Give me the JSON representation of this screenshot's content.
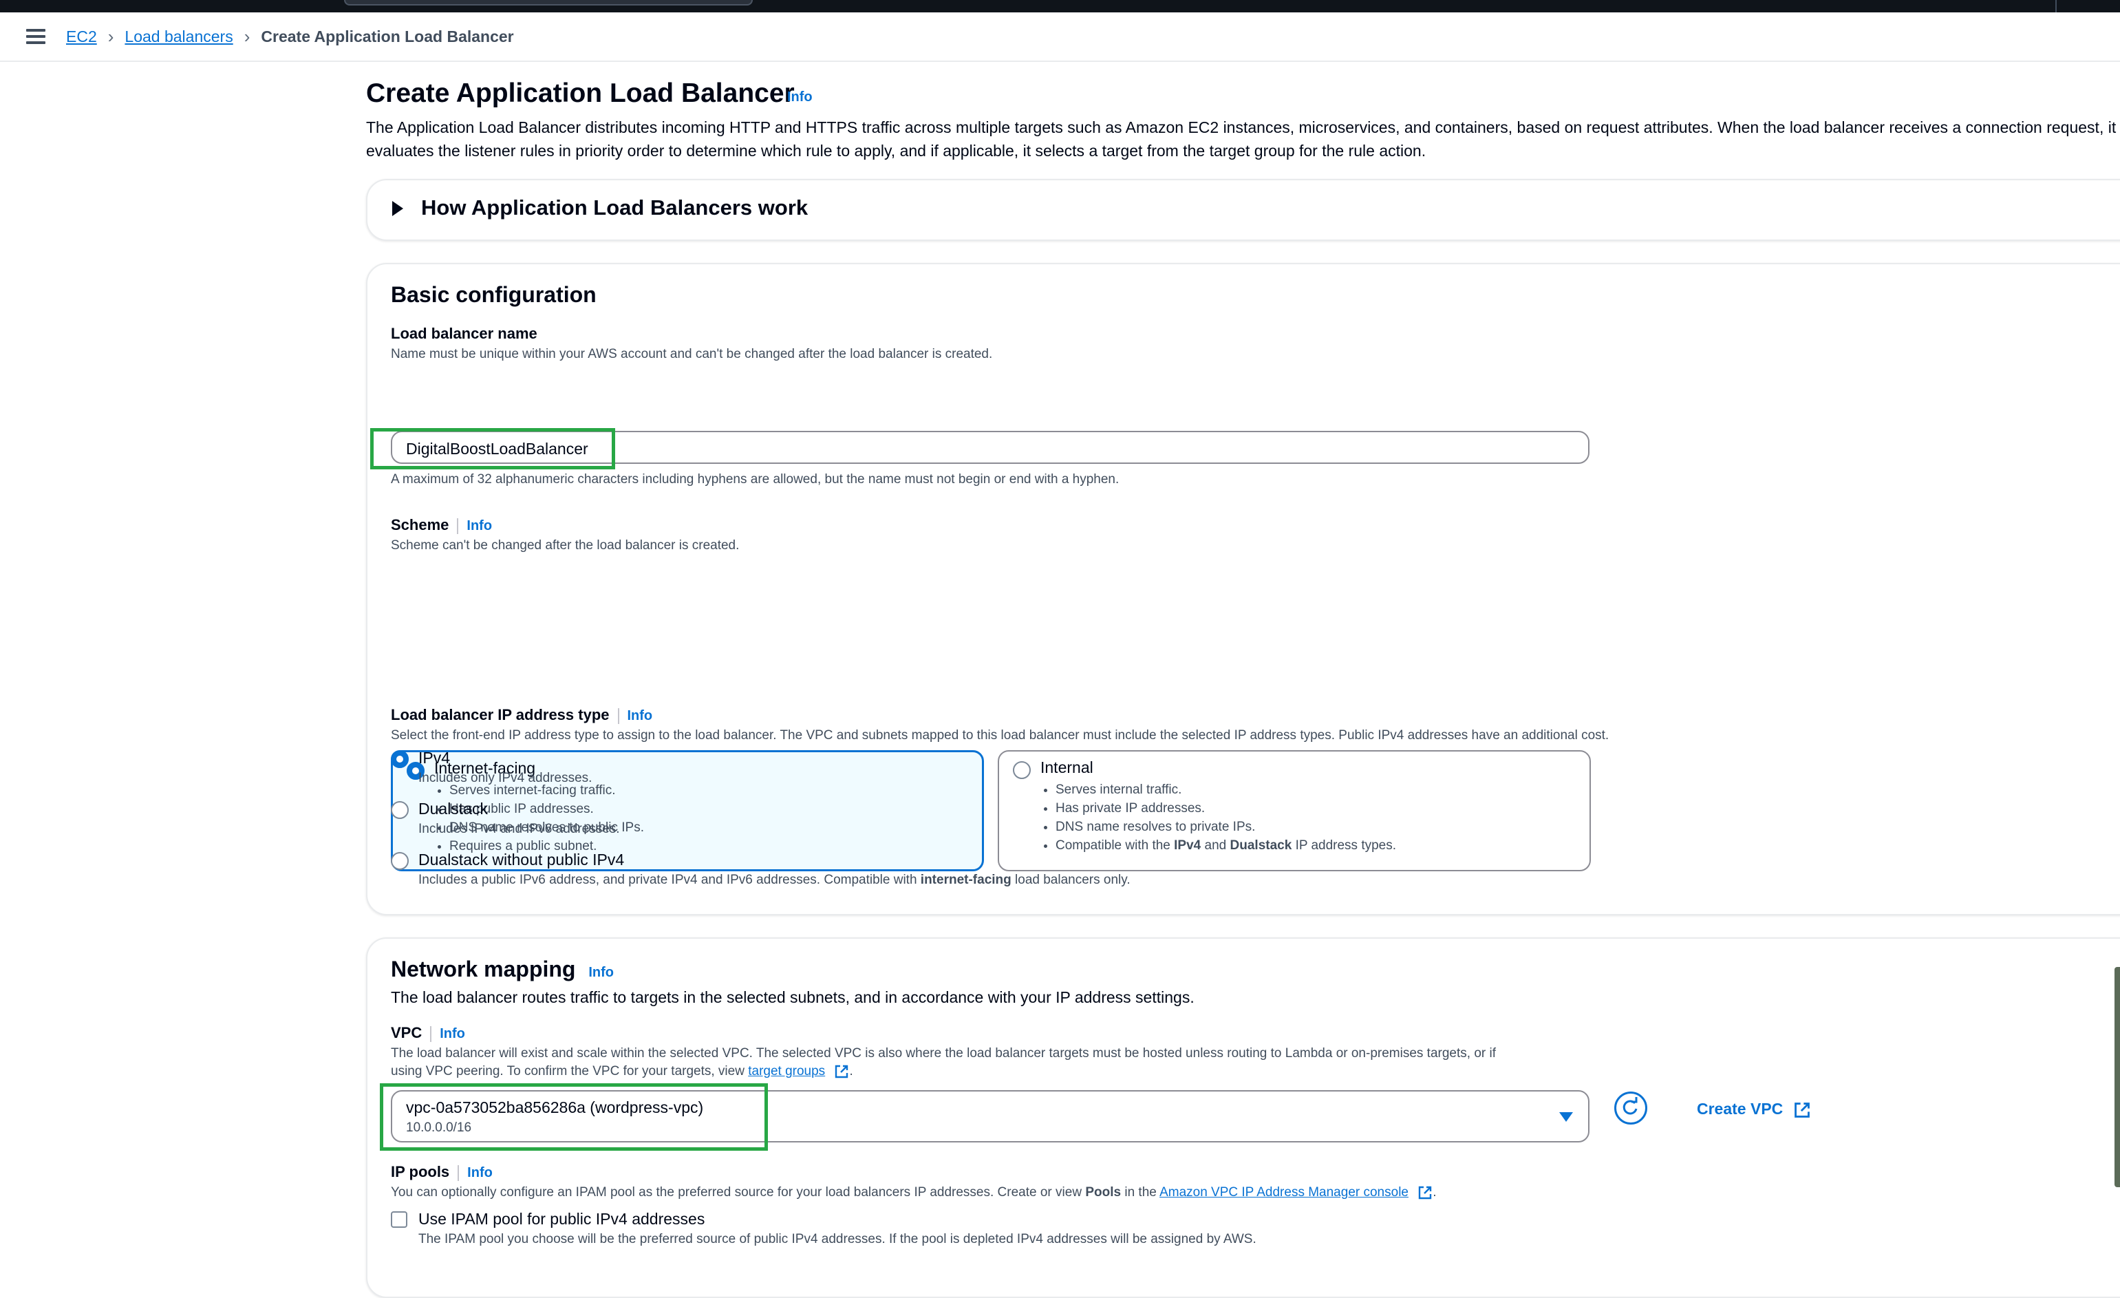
{
  "breadcrumb": {
    "items": [
      "EC2",
      "Load balancers"
    ],
    "current": "Create Application Load Balancer"
  },
  "page": {
    "title": "Create Application Load Balancer",
    "info": "Info",
    "description": "The Application Load Balancer distributes incoming HTTP and HTTPS traffic across multiple targets such as Amazon EC2 instances, microservices, and containers, based on request attributes. When the load balancer receives a connection request, it evaluates the listener rules in priority order to determine which rule to apply, and if applicable, it selects a target from the target group for the rule action."
  },
  "expander": {
    "label": "How Application Load Balancers work"
  },
  "basic": {
    "title": "Basic configuration",
    "name_label": "Load balancer name",
    "name_desc": "Name must be unique within your AWS account and can't be changed after the load balancer is created.",
    "name_value": "DigitalBoostLoadBalancer",
    "name_hint": "A maximum of 32 alphanumeric characters including hyphens are allowed, but the name must not begin or end with a hyphen.",
    "scheme_label": "Scheme",
    "scheme_info": "Info",
    "scheme_desc": "Scheme can't be changed after the load balancer is created.",
    "internet_facing": {
      "title": "Internet-facing",
      "bullets": [
        "Serves internet-facing traffic.",
        "Has public IP addresses.",
        "DNS name resolves to public IPs.",
        "Requires a public subnet."
      ]
    },
    "internal": {
      "title": "Internal",
      "b1": "Serves internal traffic.",
      "b2": "Has private IP addresses.",
      "b3": "DNS name resolves to private IPs.",
      "b4_pre": "Compatible with the ",
      "b4_ipv4": "IPv4",
      "b4_and": " and ",
      "b4_dual": "Dualstack",
      "b4_post": " IP address types."
    },
    "ip_label": "Load balancer IP address type",
    "ip_info": "Info",
    "ip_desc": "Select the front-end IP address type to assign to the load balancer. The VPC and subnets mapped to this load balancer must include the selected IP address types. Public IPv4 addresses have an additional cost.",
    "ipv4": {
      "label": "IPv4",
      "desc": "Includes only IPv4 addresses."
    },
    "dualstack": {
      "label": "Dualstack",
      "desc": "Includes IPv4 and IPv6 addresses."
    },
    "dualstack_nopub": {
      "label": "Dualstack without public IPv4",
      "desc_pre": "Includes a public IPv6 address, and private IPv4 and IPv6 addresses. Compatible with ",
      "desc_bold": "internet-facing",
      "desc_post": " load balancers only."
    }
  },
  "network": {
    "title": "Network mapping",
    "info": "Info",
    "desc": "The load balancer routes traffic to targets in the selected subnets, and in accordance with your IP address settings.",
    "vpc_label": "VPC",
    "vpc_info": "Info",
    "vpc_desc1": "The load balancer will exist and scale within the selected VPC. The selected VPC is also where the load balancer targets must be hosted unless routing to Lambda or on-premises targets, or if",
    "vpc_desc2_pre": "using VPC peering. To confirm the VPC for your targets, view ",
    "vpc_desc2_link": "target groups",
    "vpc_value": "vpc-0a573052ba856286a (wordpress-vpc)",
    "vpc_cidr": "10.0.0.0/16",
    "create_vpc": "Create VPC",
    "ippools_label": "IP pools",
    "ippools_info": "Info",
    "ippools_desc_pre": "You can optionally configure an IPAM pool as the preferred source for your load balancers IP addresses. Create or view ",
    "ippools_desc_bold": "Pools",
    "ippools_desc_mid": " in the ",
    "ippools_desc_link": "Amazon VPC IP Address Manager console",
    "ipam_checkbox": "Use IPAM pool for public IPv4 addresses",
    "ipam_desc": "The IPAM pool you choose will be the preferred source of public IPv4 addresses. If the pool is depleted IPv4 addresses will be assigned by AWS."
  },
  "colors": {
    "accent": "#0972d3",
    "highlight": "#28a745",
    "selected_bg": "#f0fbff"
  }
}
